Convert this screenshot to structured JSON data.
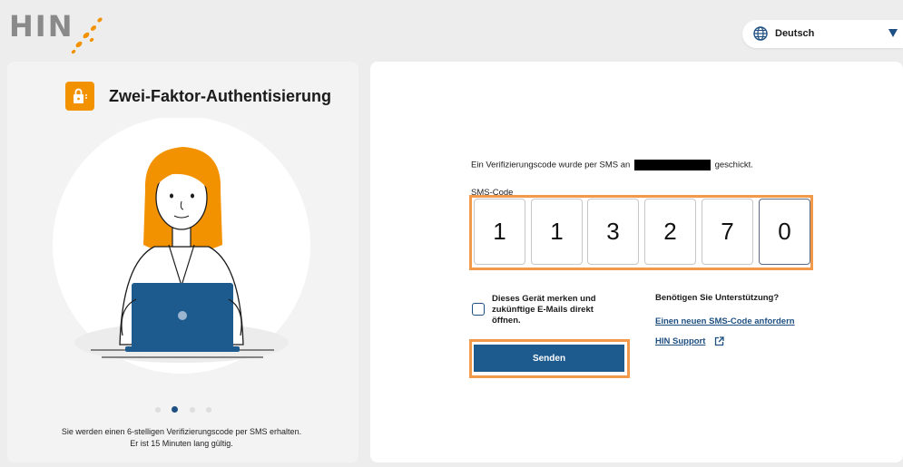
{
  "header": {
    "logo_text": "HIN",
    "language": "Deutsch",
    "icons": [
      "globe-icon",
      "chevron-down-icon"
    ]
  },
  "left_panel": {
    "title": "Zwei-Faktor-Authentisierung",
    "carousel_total": 4,
    "carousel_active": 2,
    "caption_line1": "Sie werden einen 6-stelligen Verifizierungscode per SMS erhalten.",
    "caption_line2": "Er ist 15 Minuten lang gültig."
  },
  "form": {
    "info_prefix": "Ein Verifizierungscode wurde per SMS an",
    "info_suffix": "geschickt.",
    "sms_label": "SMS-Code",
    "digits": [
      "1",
      "1",
      "3",
      "2",
      "7",
      "0"
    ],
    "remember_label": "Dieses Gerät merken und zukünftige E-Mails direkt öffnen.",
    "remember_checked": false,
    "send_label": "Senden"
  },
  "help": {
    "title": "Benötigen Sie Unterstützung?",
    "new_code_link": "Einen neuen SMS-Code anfordern",
    "support_link": "HIN Support"
  },
  "colors": {
    "brand_orange": "#f39200",
    "highlight_orange": "#f39a4a",
    "primary_blue": "#1d5a8e",
    "link_blue": "#1d4f82"
  }
}
